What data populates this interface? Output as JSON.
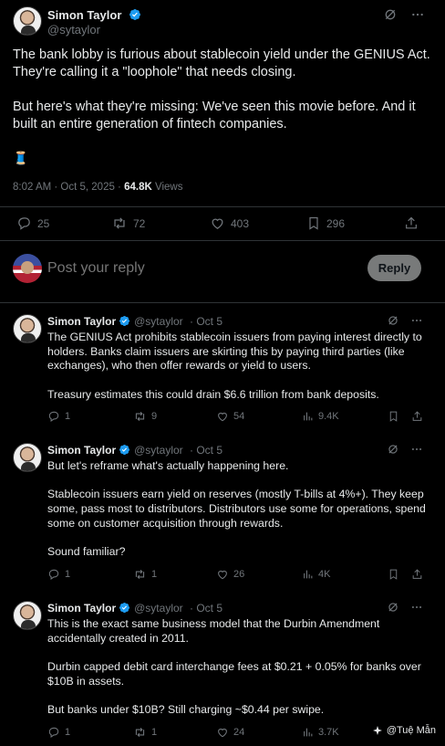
{
  "main_tweet": {
    "author_name": "Simon Taylor",
    "handle": "@sytaylor",
    "paragraph_1": "The bank lobby is furious about stablecoin yield under the GENIUS Act. They're calling it a \"loophole\" that needs closing.",
    "paragraph_2": "But here's what they're missing: We've seen this movie before. And it built an entire generation of fintech companies.",
    "emoji": "🧵",
    "timestamp": "8:02 AM · Oct 5, 2025 · ",
    "views_count": "64.8K",
    "views_label": " Views",
    "replies": "25",
    "reposts": "72",
    "likes": "403",
    "bookmarks": "296"
  },
  "reply_box": {
    "placeholder": "Post your reply",
    "button_label": "Reply"
  },
  "thread": [
    {
      "author_name": "Simon Taylor",
      "handle": "@sytaylor",
      "date": "· Oct 5",
      "paragraphs": [
        "The GENIUS Act prohibits stablecoin issuers from paying interest directly to holders. Banks claim issuers are skirting this by paying third parties (like exchanges), who then offer rewards or yield to users.",
        "Treasury estimates this could drain $6.6 trillion from bank deposits."
      ],
      "replies": "1",
      "reposts": "9",
      "likes": "54",
      "views": "9.4K"
    },
    {
      "author_name": "Simon Taylor",
      "handle": "@sytaylor",
      "date": "· Oct 5",
      "paragraphs": [
        "But let's reframe what's actually happening here.",
        "Stablecoin issuers earn yield on reserves (mostly T-bills at 4%+). They keep some, pass most to distributors. Distributors use some for operations, spend some on customer acquisition through rewards.",
        "Sound familiar?"
      ],
      "replies": "1",
      "reposts": "1",
      "likes": "26",
      "views": "4K"
    },
    {
      "author_name": "Simon Taylor",
      "handle": "@sytaylor",
      "date": "· Oct 5",
      "paragraphs": [
        "This is the exact same business model that the Durbin Amendment accidentally created in 2011.",
        "Durbin capped debit card interchange fees at $0.21 + 0.05% for banks over $10B in assets.",
        "But banks under $10B? Still charging ~$0.44 per swipe."
      ],
      "replies": "1",
      "reposts": "1",
      "likes": "24",
      "views": "3.7K"
    }
  ],
  "watermark": "@Tuệ Mẫn",
  "colors": {
    "background": "#000000",
    "text": "#e7e9ea",
    "muted": "#71767b",
    "border": "#2f3336",
    "verified": "#1d9bf0",
    "reply_button": "#787a7a"
  }
}
